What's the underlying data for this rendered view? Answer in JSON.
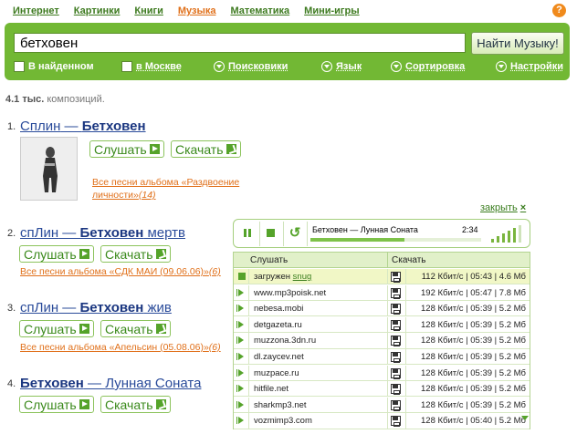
{
  "nav": {
    "items": [
      {
        "label": "Интернет",
        "active": false
      },
      {
        "label": "Картинки",
        "active": false
      },
      {
        "label": "Книги",
        "active": false
      },
      {
        "label": "Музыка",
        "active": true
      },
      {
        "label": "Математика",
        "active": false
      },
      {
        "label": "Мини-игры",
        "active": false
      }
    ],
    "help_label": "?"
  },
  "search": {
    "query": "бетховен",
    "button_label": "Найти Музыку!",
    "filters": {
      "in_found": "В найденном",
      "in_moscow": "в Москве",
      "engines": "Поисковики",
      "language": "Язык",
      "sort": "Сортировка",
      "settings": "Настройки"
    }
  },
  "results": {
    "count": "4.1 тыс.",
    "count_suffix": "композиций.",
    "listen_label": "Слушать",
    "download_label": "Скачать",
    "items": [
      {
        "num": "1.",
        "artist": "Сплин",
        "dash": " — ",
        "title_bold": "Бетховен",
        "title_rest": "",
        "album_link": "Все песни альбома «Раздвоение",
        "album_link2": "личности»",
        "album_count": "(14)"
      },
      {
        "num": "2.",
        "artist": "спЛин",
        "dash": " — ",
        "title_bold": "Бетховен",
        "title_rest": " мертв",
        "album_link": "Все песни альбома «СДК МАИ (09.06.06)»",
        "album_count": "(6)"
      },
      {
        "num": "3.",
        "artist": "спЛин",
        "dash": " — ",
        "title_bold": "Бетховен",
        "title_rest": " жив",
        "album_link": "Все песни альбома «Апельсин (05.08.06)»",
        "album_count": "(6)"
      },
      {
        "num": "4.",
        "artist": "Бетховен",
        "dash": " — ",
        "title_bold": "",
        "title_rest": "Лунная Соната"
      }
    ]
  },
  "player": {
    "close_label": "закрыть",
    "close_x": "×",
    "track": "Бетховен — Лунная Соната",
    "time": "2:34",
    "progress": 0.55,
    "volume_level": 5,
    "volume_max": 6
  },
  "sources": {
    "head_listen": "Слушать",
    "head_download": "Скачать",
    "rows": [
      {
        "site": "загружен ",
        "site_link": "snug",
        "info": "112 Кбит/с | 05:43 | 4.6 Мб",
        "active": true
      },
      {
        "site": "www.mp3poisk.net",
        "info": "192 Кбит/с | 05:47 | 7.8 Мб"
      },
      {
        "site": "nebesa.mobi",
        "info": "128 Кбит/с | 05:39 | 5.2 Мб"
      },
      {
        "site": "detgazeta.ru",
        "info": "128 Кбит/с | 05:39 | 5.2 Мб"
      },
      {
        "site": "muzzona.3dn.ru",
        "info": "128 Кбит/с | 05:39 | 5.2 Мб"
      },
      {
        "site": "dl.zaycev.net",
        "info": "128 Кбит/с | 05:39 | 5.2 Мб"
      },
      {
        "site": "muzpace.ru",
        "info": "128 Кбит/с | 05:39 | 5.2 Мб"
      },
      {
        "site": "hitfile.net",
        "info": "128 Кбит/с | 05:39 | 5.2 Мб"
      },
      {
        "site": "sharkmp3.net",
        "info": "128 Кбит/с | 05:39 | 5.2 Мб"
      },
      {
        "site": "vozmimp3.com",
        "info": "128 Кбит/с | 05:40 | 5.2 Мб"
      }
    ]
  }
}
